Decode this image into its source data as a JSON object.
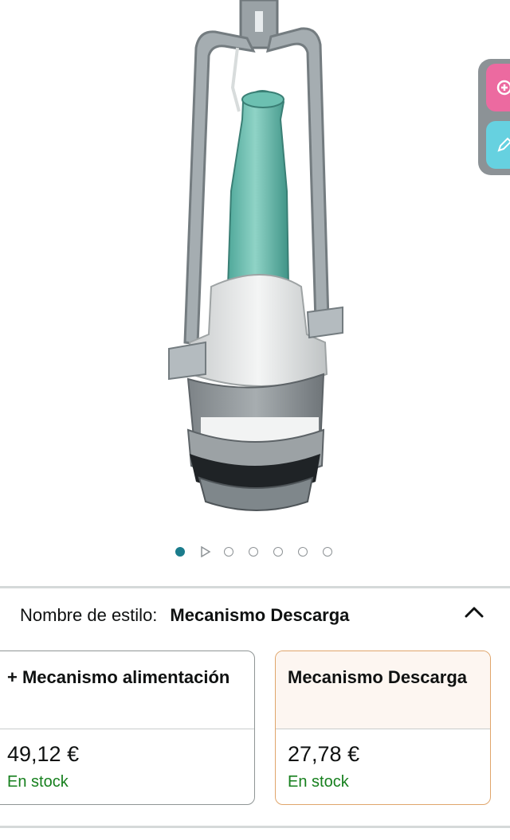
{
  "gallery": {
    "image_alt": "Mecanismo de descarga para cisterna",
    "current_index": 1,
    "total_images": 7,
    "dots": [
      {
        "type": "image",
        "active": true
      },
      {
        "type": "video",
        "active": false
      },
      {
        "type": "image",
        "active": false
      },
      {
        "type": "image",
        "active": false
      },
      {
        "type": "image",
        "active": false
      },
      {
        "type": "image",
        "active": false
      },
      {
        "type": "image",
        "active": false
      }
    ]
  },
  "side_tools": {
    "zoom_icon": "zoom-plus-icon",
    "edit_icon": "pencil-icon",
    "colors": {
      "zoom": "#ec6aa0",
      "edit": "#66d1e0",
      "panel": "#8c9296"
    }
  },
  "style_selector": {
    "label": "Nombre de estilo:",
    "selected": "Mecanismo Descarga",
    "collapse_icon": "chevron-up-icon",
    "options": [
      {
        "name": "+ Mecanismo alimentación",
        "price": "49,12 €",
        "stock": "En stock",
        "selected": false
      },
      {
        "name": "Mecanismo Descarga",
        "price": "27,78 €",
        "stock": "En stock",
        "selected": true
      }
    ]
  },
  "colors": {
    "dot_active": "#1b7c8c",
    "stock_green": "#17801e",
    "selected_border": "#e0a56b"
  }
}
